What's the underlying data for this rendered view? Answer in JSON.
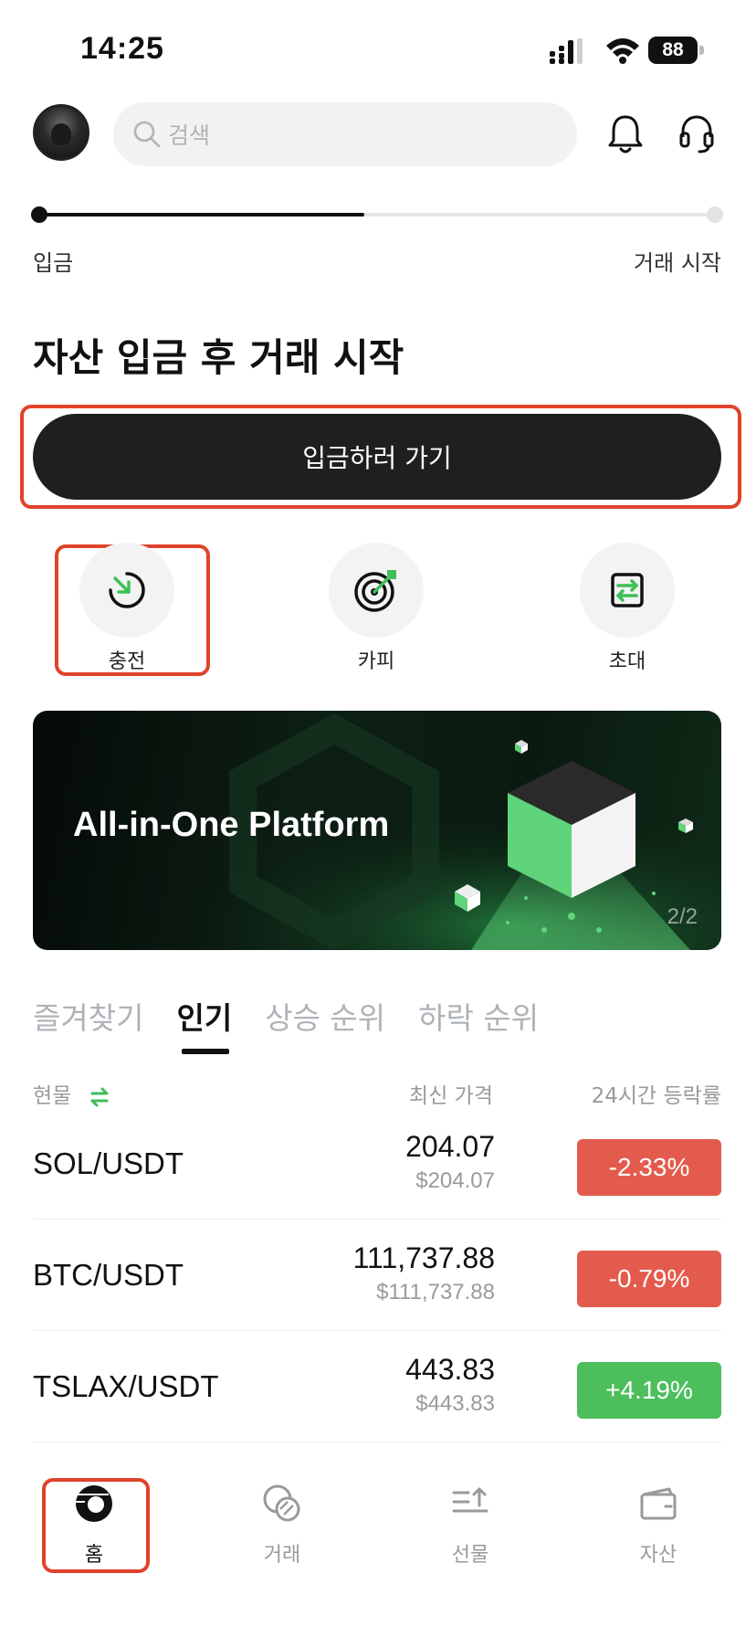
{
  "status_bar": {
    "time": "14:25",
    "battery": "88"
  },
  "header": {
    "search_placeholder": "검색"
  },
  "progress": {
    "start_label": "입금",
    "end_label": "거래 시작",
    "fraction": 0.48
  },
  "headline": "자산 입금 후 거래 시작",
  "deposit_button": "입금하러 가기",
  "quick_actions": [
    {
      "label": "충전",
      "icon": "deposit-arrow-icon"
    },
    {
      "label": "카피",
      "icon": "target-icon"
    },
    {
      "label": "초대",
      "icon": "invite-swap-icon"
    }
  ],
  "banner": {
    "title": "All-in-One Platform",
    "page": "2/2"
  },
  "market_tabs": [
    "즐겨찾기",
    "인기",
    "상승 순위",
    "하락 순위"
  ],
  "active_tab": "인기",
  "columns": {
    "spot": "현물",
    "latest_price": "최신 가격",
    "change_24h": "24시간 등락률"
  },
  "markets": [
    {
      "pair": "SOL/USDT",
      "price": "204.07",
      "price_usd": "$204.07",
      "change": "-2.33%",
      "direction": "down"
    },
    {
      "pair": "BTC/USDT",
      "price": "111,737.88",
      "price_usd": "$111,737.88",
      "change": "-0.79%",
      "direction": "down"
    },
    {
      "pair": "TSLAX/USDT",
      "price": "443.83",
      "price_usd": "$443.83",
      "change": "+4.19%",
      "direction": "up"
    }
  ],
  "bottom_nav": [
    {
      "label": "홈",
      "icon": "home-icon",
      "active": true
    },
    {
      "label": "거래",
      "icon": "trade-icon",
      "active": false
    },
    {
      "label": "선물",
      "icon": "futures-icon",
      "active": false
    },
    {
      "label": "자산",
      "icon": "wallet-icon",
      "active": false
    }
  ],
  "colors": {
    "negative": "#e35b4d",
    "positive": "#4cbe5c",
    "highlight": "#e0432b",
    "brand_green": "#5fd47a"
  }
}
